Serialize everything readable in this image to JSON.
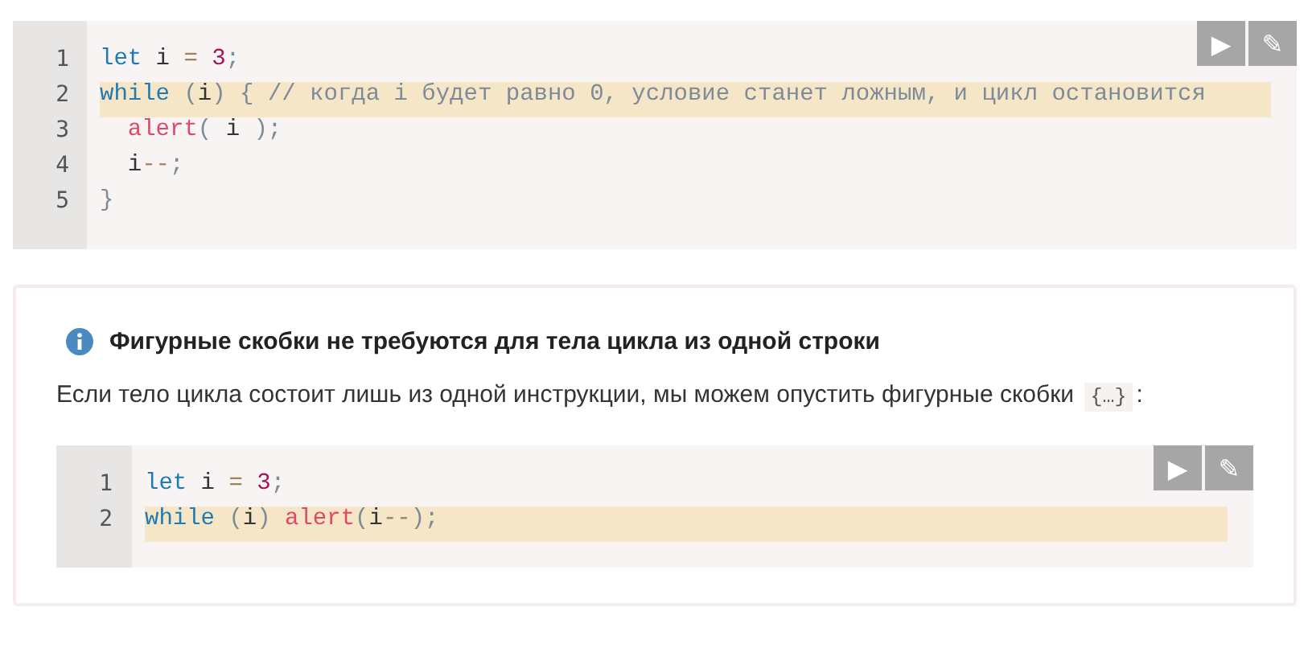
{
  "code_block": {
    "run_button": "▶",
    "edit_button": "✎",
    "lines": [
      {
        "number": "1",
        "highlighted": false,
        "tokens": [
          {
            "kind": "keyword",
            "text": "let"
          },
          {
            "kind": "plain",
            "text": " i "
          },
          {
            "kind": "operator",
            "text": "= "
          },
          {
            "kind": "number",
            "text": "3"
          },
          {
            "kind": "punct",
            "text": ";"
          }
        ]
      },
      {
        "number": "2",
        "highlighted": true,
        "tokens": [
          {
            "kind": "keyword",
            "text": "while "
          },
          {
            "kind": "punct",
            "text": "("
          },
          {
            "kind": "plain",
            "text": "i"
          },
          {
            "kind": "punct",
            "text": ") { "
          },
          {
            "kind": "comment",
            "text": "// когда i будет равно 0, условие станет ложным, и цикл остановится"
          }
        ]
      },
      {
        "number": "3",
        "highlighted": false,
        "tokens": [
          {
            "kind": "function",
            "text": "  alert"
          },
          {
            "kind": "punct",
            "text": "("
          },
          {
            "kind": "plain",
            "text": " i "
          },
          {
            "kind": "punct",
            "text": ");"
          }
        ]
      },
      {
        "number": "4",
        "highlighted": false,
        "tokens": [
          {
            "kind": "plain",
            "text": "  i"
          },
          {
            "kind": "operator",
            "text": "--"
          },
          {
            "kind": "punct",
            "text": ";"
          }
        ]
      },
      {
        "number": "5",
        "highlighted": false,
        "tokens": [
          {
            "kind": "punct",
            "text": "}"
          }
        ]
      }
    ]
  },
  "info_box": {
    "title": "Фигурные скобки не требуются для тела цикла из одной строки",
    "text": "Если тело цикла состоит лишь из одной инструкции, мы можем опустить фигурные скобки",
    "inline_code": "{…}",
    "text_end": ":",
    "code_block": {
      "run_button": "▶",
      "edit_button": "✎",
      "lines": [
        {
          "number": "1",
          "highlighted": false,
          "tokens": [
            {
              "kind": "keyword",
              "text": "let"
            },
            {
              "kind": "plain",
              "text": " i "
            },
            {
              "kind": "operator",
              "text": "= "
            },
            {
              "kind": "number",
              "text": "3"
            },
            {
              "kind": "punct",
              "text": ";"
            }
          ]
        },
        {
          "number": "2",
          "highlighted": true,
          "tokens": [
            {
              "kind": "keyword",
              "text": "while "
            },
            {
              "kind": "punct",
              "text": "("
            },
            {
              "kind": "plain",
              "text": "i"
            },
            {
              "kind": "punct",
              "text": ") "
            },
            {
              "kind": "function",
              "text": "alert"
            },
            {
              "kind": "punct",
              "text": "("
            },
            {
              "kind": "plain",
              "text": "i"
            },
            {
              "kind": "operator",
              "text": "--"
            },
            {
              "kind": "punct",
              "text": ");"
            }
          ]
        }
      ]
    }
  }
}
